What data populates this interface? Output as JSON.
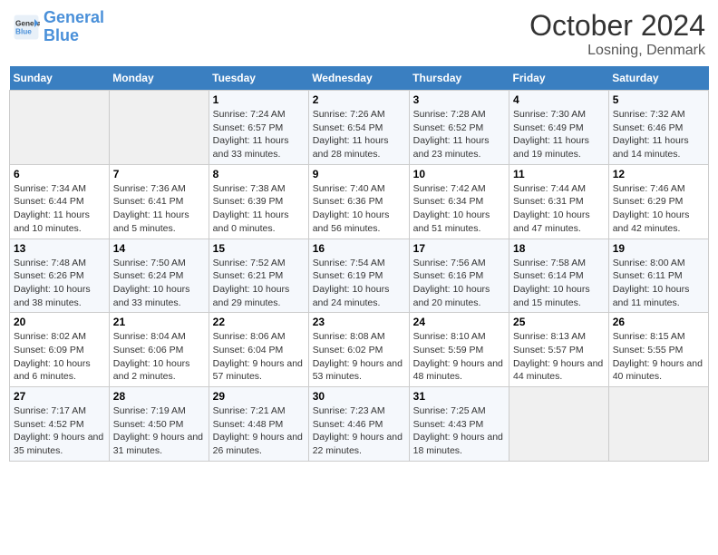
{
  "header": {
    "logo_line1": "General",
    "logo_line2": "Blue",
    "month": "October 2024",
    "location": "Losning, Denmark"
  },
  "days_of_week": [
    "Sunday",
    "Monday",
    "Tuesday",
    "Wednesday",
    "Thursday",
    "Friday",
    "Saturday"
  ],
  "weeks": [
    [
      {
        "num": "",
        "info": ""
      },
      {
        "num": "",
        "info": ""
      },
      {
        "num": "1",
        "info": "Sunrise: 7:24 AM\nSunset: 6:57 PM\nDaylight: 11 hours and 33 minutes."
      },
      {
        "num": "2",
        "info": "Sunrise: 7:26 AM\nSunset: 6:54 PM\nDaylight: 11 hours and 28 minutes."
      },
      {
        "num": "3",
        "info": "Sunrise: 7:28 AM\nSunset: 6:52 PM\nDaylight: 11 hours and 23 minutes."
      },
      {
        "num": "4",
        "info": "Sunrise: 7:30 AM\nSunset: 6:49 PM\nDaylight: 11 hours and 19 minutes."
      },
      {
        "num": "5",
        "info": "Sunrise: 7:32 AM\nSunset: 6:46 PM\nDaylight: 11 hours and 14 minutes."
      }
    ],
    [
      {
        "num": "6",
        "info": "Sunrise: 7:34 AM\nSunset: 6:44 PM\nDaylight: 11 hours and 10 minutes."
      },
      {
        "num": "7",
        "info": "Sunrise: 7:36 AM\nSunset: 6:41 PM\nDaylight: 11 hours and 5 minutes."
      },
      {
        "num": "8",
        "info": "Sunrise: 7:38 AM\nSunset: 6:39 PM\nDaylight: 11 hours and 0 minutes."
      },
      {
        "num": "9",
        "info": "Sunrise: 7:40 AM\nSunset: 6:36 PM\nDaylight: 10 hours and 56 minutes."
      },
      {
        "num": "10",
        "info": "Sunrise: 7:42 AM\nSunset: 6:34 PM\nDaylight: 10 hours and 51 minutes."
      },
      {
        "num": "11",
        "info": "Sunrise: 7:44 AM\nSunset: 6:31 PM\nDaylight: 10 hours and 47 minutes."
      },
      {
        "num": "12",
        "info": "Sunrise: 7:46 AM\nSunset: 6:29 PM\nDaylight: 10 hours and 42 minutes."
      }
    ],
    [
      {
        "num": "13",
        "info": "Sunrise: 7:48 AM\nSunset: 6:26 PM\nDaylight: 10 hours and 38 minutes."
      },
      {
        "num": "14",
        "info": "Sunrise: 7:50 AM\nSunset: 6:24 PM\nDaylight: 10 hours and 33 minutes."
      },
      {
        "num": "15",
        "info": "Sunrise: 7:52 AM\nSunset: 6:21 PM\nDaylight: 10 hours and 29 minutes."
      },
      {
        "num": "16",
        "info": "Sunrise: 7:54 AM\nSunset: 6:19 PM\nDaylight: 10 hours and 24 minutes."
      },
      {
        "num": "17",
        "info": "Sunrise: 7:56 AM\nSunset: 6:16 PM\nDaylight: 10 hours and 20 minutes."
      },
      {
        "num": "18",
        "info": "Sunrise: 7:58 AM\nSunset: 6:14 PM\nDaylight: 10 hours and 15 minutes."
      },
      {
        "num": "19",
        "info": "Sunrise: 8:00 AM\nSunset: 6:11 PM\nDaylight: 10 hours and 11 minutes."
      }
    ],
    [
      {
        "num": "20",
        "info": "Sunrise: 8:02 AM\nSunset: 6:09 PM\nDaylight: 10 hours and 6 minutes."
      },
      {
        "num": "21",
        "info": "Sunrise: 8:04 AM\nSunset: 6:06 PM\nDaylight: 10 hours and 2 minutes."
      },
      {
        "num": "22",
        "info": "Sunrise: 8:06 AM\nSunset: 6:04 PM\nDaylight: 9 hours and 57 minutes."
      },
      {
        "num": "23",
        "info": "Sunrise: 8:08 AM\nSunset: 6:02 PM\nDaylight: 9 hours and 53 minutes."
      },
      {
        "num": "24",
        "info": "Sunrise: 8:10 AM\nSunset: 5:59 PM\nDaylight: 9 hours and 48 minutes."
      },
      {
        "num": "25",
        "info": "Sunrise: 8:13 AM\nSunset: 5:57 PM\nDaylight: 9 hours and 44 minutes."
      },
      {
        "num": "26",
        "info": "Sunrise: 8:15 AM\nSunset: 5:55 PM\nDaylight: 9 hours and 40 minutes."
      }
    ],
    [
      {
        "num": "27",
        "info": "Sunrise: 7:17 AM\nSunset: 4:52 PM\nDaylight: 9 hours and 35 minutes."
      },
      {
        "num": "28",
        "info": "Sunrise: 7:19 AM\nSunset: 4:50 PM\nDaylight: 9 hours and 31 minutes."
      },
      {
        "num": "29",
        "info": "Sunrise: 7:21 AM\nSunset: 4:48 PM\nDaylight: 9 hours and 26 minutes."
      },
      {
        "num": "30",
        "info": "Sunrise: 7:23 AM\nSunset: 4:46 PM\nDaylight: 9 hours and 22 minutes."
      },
      {
        "num": "31",
        "info": "Sunrise: 7:25 AM\nSunset: 4:43 PM\nDaylight: 9 hours and 18 minutes."
      },
      {
        "num": "",
        "info": ""
      },
      {
        "num": "",
        "info": ""
      }
    ]
  ]
}
